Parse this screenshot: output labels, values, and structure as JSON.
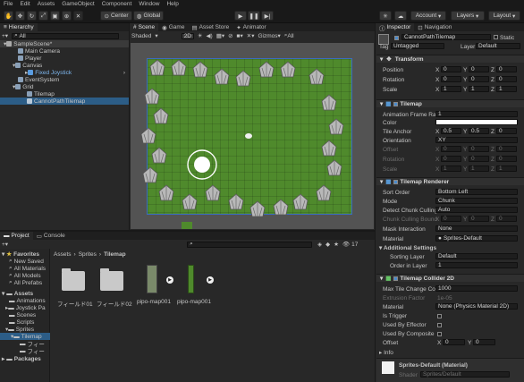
{
  "menu": [
    "File",
    "Edit",
    "Assets",
    "GameObject",
    "Component",
    "Window",
    "Help"
  ],
  "toolbar": {
    "center": "Center",
    "global": "Global",
    "account": "Account",
    "layers": "Layers",
    "layout": "Layout"
  },
  "hierarchy": {
    "title": "Hierarchy",
    "search": "All",
    "items": [
      "SampleScene*",
      "Main Camera",
      "Player",
      "Canvas",
      "Fixed Joystick",
      "EventSystem",
      "Grid",
      "Tilemap",
      "CannotPathTilemap"
    ]
  },
  "scene": {
    "tabs": [
      "Scene",
      "Game",
      "Asset Store",
      "Animator"
    ],
    "shading": "Shaded",
    "mode2d": "2D",
    "gizmos": "Gizmos",
    "all": "All"
  },
  "project": {
    "tabs": [
      "Project",
      "Console"
    ],
    "count": "17",
    "favorites": [
      "Favorites",
      "New Saved",
      "All Materials",
      "All Models",
      "All Prefabs"
    ],
    "assets": [
      "Assets",
      "Animations",
      "Joystick Pa",
      "Scenes",
      "Scripts",
      "Sprites",
      "Tilemap",
      "フィー",
      "フィー"
    ],
    "packages": "Packages",
    "breadcrumb": [
      "Assets",
      "Sprites",
      "Tilemap"
    ],
    "files": [
      "フィールド01",
      "フィールド02",
      "pipo-map001",
      "pipo-map001"
    ]
  },
  "inspector": {
    "tabs": [
      "Inspector",
      "Navigation"
    ],
    "name": "CannotPathTilemap",
    "static": "Static",
    "tag_label": "Tag",
    "tag": "Untagged",
    "layer_label": "Layer",
    "layer": "Default",
    "transform": {
      "title": "Transform",
      "position": "Position",
      "rotation": "Rotation",
      "scale": "Scale",
      "pos": [
        "0",
        "0",
        "0"
      ],
      "rot": [
        "0",
        "0",
        "0"
      ],
      "scl": [
        "1",
        "1",
        "1"
      ]
    },
    "tilemap": {
      "title": "Tilemap",
      "frame_rate": "Animation Frame Rate",
      "frame_rate_val": "1",
      "color": "Color",
      "anchor": "Tile Anchor",
      "anchor_vals": [
        "0.5",
        "0.5",
        "0"
      ],
      "orientation": "Orientation",
      "orientation_val": "XY",
      "offset": "Offset",
      "rotation": "Rotation",
      "scale": "Scale",
      "off_vals": [
        "0",
        "0",
        "0"
      ],
      "rot_vals": [
        "0",
        "0",
        "0"
      ],
      "scl_vals": [
        "1",
        "1",
        "1"
      ]
    },
    "renderer": {
      "title": "Tilemap Renderer",
      "sort_order": "Sort Order",
      "sort_order_val": "Bottom Left",
      "mode": "Mode",
      "mode_val": "Chunk",
      "detect": "Detect Chunk Culling",
      "detect_val": "Auto",
      "bounds": "Chunk Culling Bound",
      "bounds_vals": [
        "0",
        "0",
        "0"
      ],
      "mask": "Mask Interaction",
      "mask_val": "None",
      "material": "Material",
      "material_val": "Sprites-Default",
      "additional": "Additional Settings",
      "sorting_layer": "Sorting Layer",
      "sorting_layer_val": "Default",
      "order": "Order in Layer",
      "order_val": "1"
    },
    "collider": {
      "title": "Tilemap Collider 2D",
      "max_tile": "Max Tile Change Cou",
      "max_tile_val": "1000",
      "extrusion": "Extrusion Factor",
      "extrusion_val": "1e-05",
      "material": "Material",
      "material_val": "None (Physics Material 2D)",
      "trigger": "Is Trigger",
      "effector": "Used By Effector",
      "composite": "Used By Composite",
      "offset": "Offset",
      "offset_vals": [
        "0",
        "0"
      ],
      "info": "Info"
    },
    "mat_preview": {
      "name": "Sprites-Default (Material)",
      "shader_label": "Shader",
      "shader": "Sprites/Default"
    }
  },
  "colors": {
    "accent": "#2c5d87",
    "grass": "#4f8a2c",
    "panel": "#282828"
  }
}
